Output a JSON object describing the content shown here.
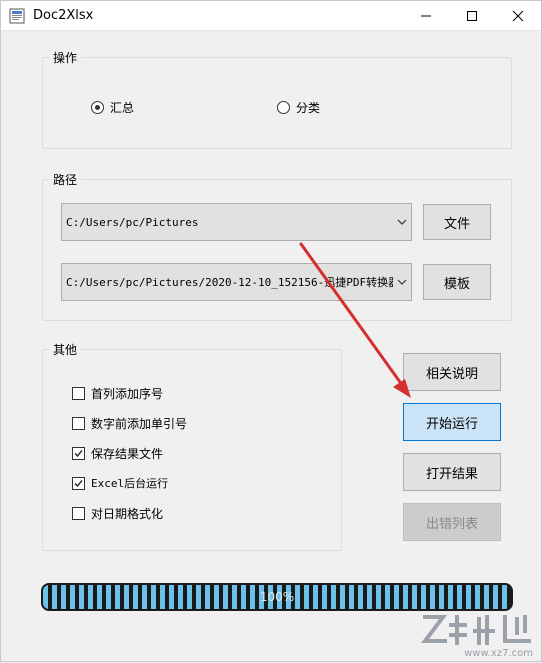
{
  "window": {
    "title": "Doc2Xlsx"
  },
  "operation": {
    "legend": "操作",
    "options": [
      {
        "label": "汇总",
        "checked": true
      },
      {
        "label": "分类",
        "checked": false
      }
    ]
  },
  "path": {
    "legend": "路径",
    "file_combo_value": "C:/Users/pc/Pictures",
    "template_combo_value": "C:/Users/pc/Pictures/2020-12-10_152156-迅捷PDF转换器 (",
    "file_button": "文件",
    "template_button": "模板"
  },
  "other": {
    "legend": "其他",
    "options": [
      {
        "label": "首列添加序号",
        "checked": false
      },
      {
        "label": "数字前添加单引号",
        "checked": false
      },
      {
        "label": "保存结果文件",
        "checked": true
      },
      {
        "label": "Excel后台运行",
        "checked": true
      },
      {
        "label": "对日期格式化",
        "checked": false
      }
    ]
  },
  "actions": {
    "help": "相关说明",
    "start": "开始运行",
    "open_result": "打开结果",
    "error_list": "出错列表"
  },
  "progress": {
    "text": "100%",
    "percent": 100,
    "fill_color": "#6bc1ea"
  },
  "watermark": {
    "site": "www.xz7.com"
  },
  "colors": {
    "accent": "#0078d7",
    "arrow": "#d32f2f"
  }
}
